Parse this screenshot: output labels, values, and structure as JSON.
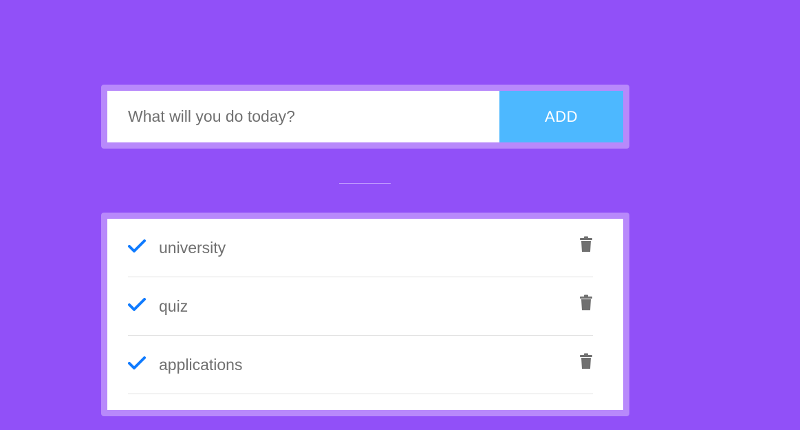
{
  "new_todo": {
    "placeholder": "What will you do today?",
    "value": "",
    "add_label": "ADD"
  },
  "todos": [
    {
      "text": "university",
      "done": true
    },
    {
      "text": "quiz",
      "done": true
    },
    {
      "text": "applications",
      "done": true
    }
  ],
  "colors": {
    "background": "#9150f8",
    "card_border": "#b889fb",
    "add_button": "#4db8ff",
    "check": "#0f7bff",
    "text": "#707070",
    "trash": "#707070"
  },
  "icons": {
    "check": "check-icon",
    "delete": "trash-icon"
  }
}
